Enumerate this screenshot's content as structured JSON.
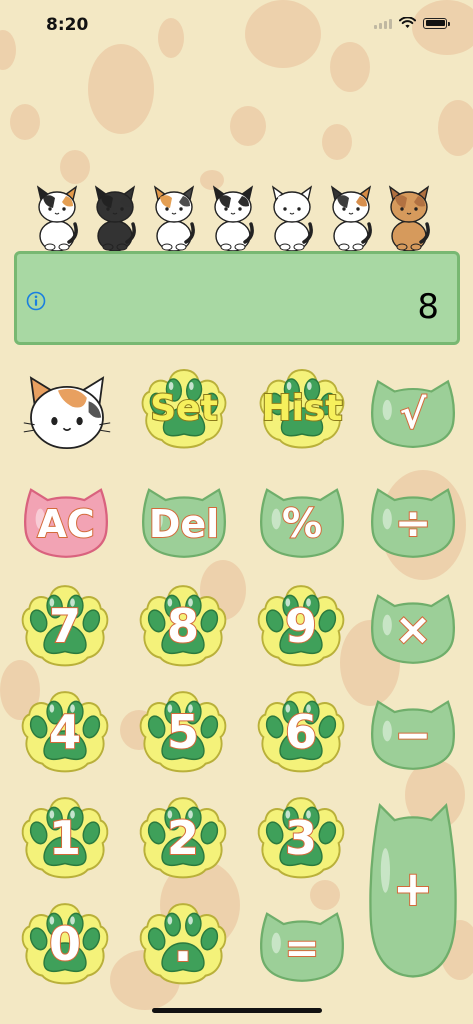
{
  "status_bar": {
    "time": "8:20"
  },
  "colors": {
    "background": "#f3e8c4",
    "polka_dot": "#ebc9a4",
    "display_bg": "#a8d8a3",
    "display_border": "#78b872",
    "key_green": "#9ccf98",
    "key_pink": "#f2a3b4",
    "paw_ring": "#f4f27a",
    "glyph_outline": "#d36a3a"
  },
  "cats": [
    {
      "name": "calico-cat-icon",
      "body": "#ffffff",
      "patch": "#222222",
      "patch2": "#e39a4a"
    },
    {
      "name": "black-cat-icon",
      "body": "#333333",
      "patch": "#222222",
      "patch2": "#333333"
    },
    {
      "name": "calico-cat-icon-2",
      "body": "#ffffff",
      "patch": "#e39a4a",
      "patch2": "#444444"
    },
    {
      "name": "tuxedo-cat-icon",
      "body": "#ffffff",
      "patch": "#222222",
      "patch2": "#222222"
    },
    {
      "name": "white-cat-icon",
      "body": "#ffffff",
      "patch": "#ffffff",
      "patch2": "#ffffff"
    },
    {
      "name": "calico-cat-icon-3",
      "body": "#ffffff",
      "patch": "#333333",
      "patch2": "#d68a44"
    },
    {
      "name": "tabby-cat-icon",
      "body": "#d69a5c",
      "patch": "#b07040",
      "patch2": "#b07040"
    }
  ],
  "display": {
    "value": "8",
    "info_icon": "info-icon"
  },
  "keys": {
    "set": "Set",
    "hist": "Hist",
    "sqrt": "√",
    "ac": "AC",
    "del": "Del",
    "percent": "%",
    "divide": "÷",
    "seven": "7",
    "eight": "8",
    "nine": "9",
    "multiply": "×",
    "four": "4",
    "five": "5",
    "six": "6",
    "minus": "−",
    "one": "1",
    "two": "2",
    "three": "3",
    "plus": "+",
    "zero": "0",
    "decimal": ".",
    "equals": "="
  }
}
